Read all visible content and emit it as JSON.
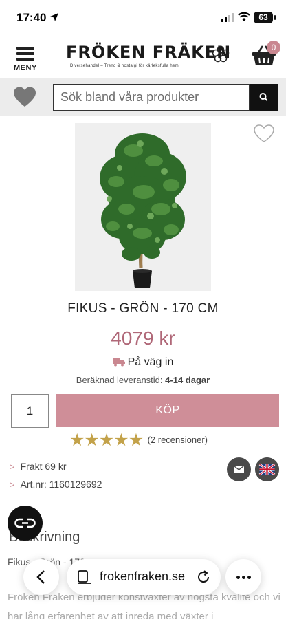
{
  "status_bar": {
    "time": "17:40",
    "battery": "63"
  },
  "header": {
    "menu_label": "MENY",
    "logo_name": "FRÖKEN FRÄKEN",
    "logo_tagline": "Diversehandel – Trend & nostalgi för kärleksfulla hem",
    "cart_count": "0"
  },
  "search": {
    "placeholder": "Sök bland våra produkter"
  },
  "product": {
    "title": "FIKUS - GRÖN - 170 CM",
    "price": "4079 kr",
    "delivery_status": "På väg in",
    "lead_time_label": "Beräknad leveranstid:",
    "lead_time_value": "4-14 dagar",
    "quantity": "1",
    "buy_label": "KÖP",
    "rating": 5,
    "reviews": "(2 recensioner)",
    "shipping": "Frakt 69 kr",
    "article_number": "Art.nr: 1160129692"
  },
  "description": {
    "heading": "Beskrivning",
    "subtitle": "Fikus - Grön - 170 cm",
    "text": "Fröken Fräken erbjuder konstväxter av högsta kvalité och vi har lång erfarenhet av att inreda med växter i"
  },
  "browser": {
    "url": "frokenfraken.se"
  },
  "colors": {
    "accent": "#cf8e98",
    "price": "#b06878",
    "star": "#c3a24a"
  }
}
